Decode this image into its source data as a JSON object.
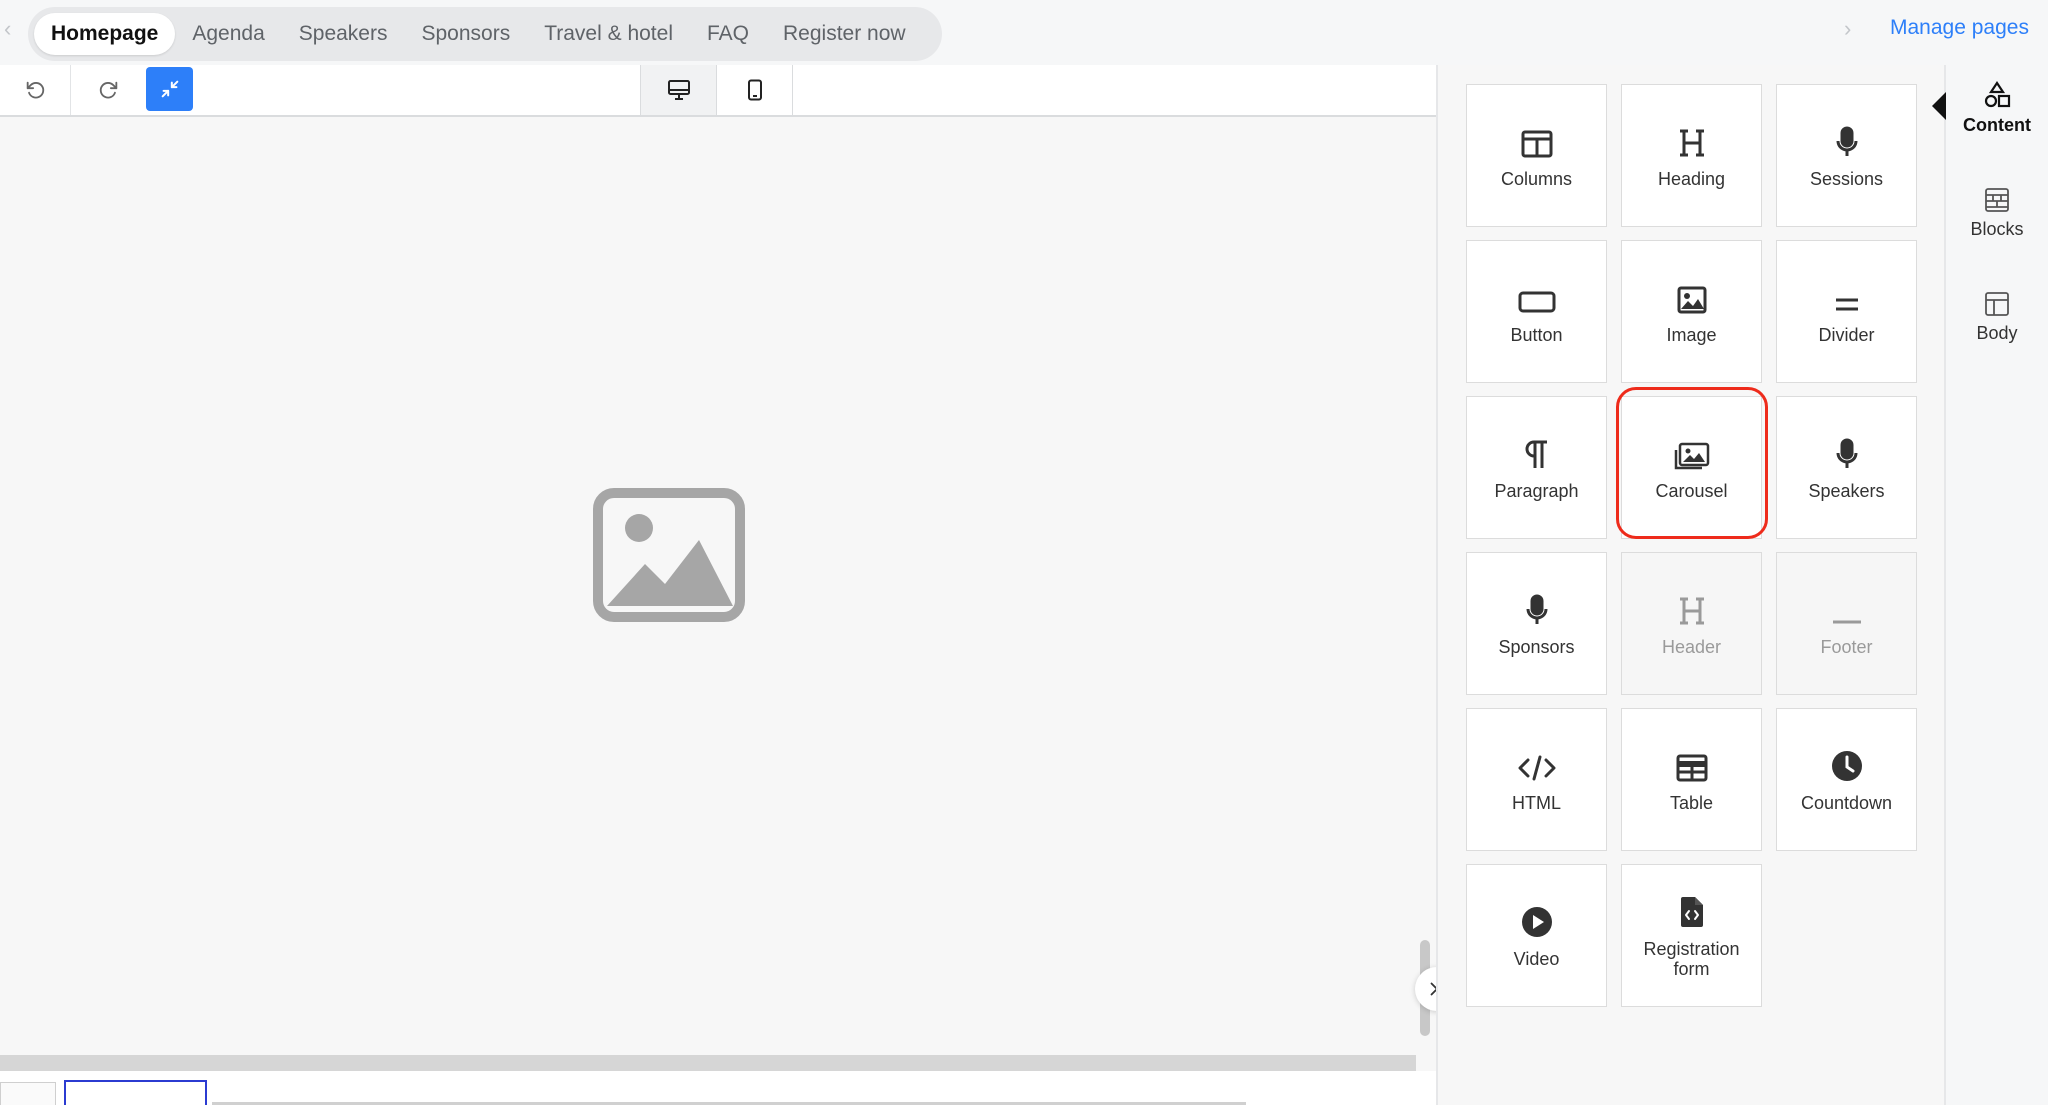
{
  "tabs": [
    {
      "label": "Homepage",
      "active": true
    },
    {
      "label": "Agenda"
    },
    {
      "label": "Speakers"
    },
    {
      "label": "Sponsors"
    },
    {
      "label": "Travel & hotel"
    },
    {
      "label": "FAQ"
    },
    {
      "label": "Register now"
    }
  ],
  "manage_pages": "Manage pages",
  "accent_color": "#2d7ff9",
  "highlight_color": "#ee2b1b",
  "content_tiles": [
    {
      "label": "Columns",
      "icon": "columns-icon"
    },
    {
      "label": "Heading",
      "icon": "heading-icon"
    },
    {
      "label": "Sessions",
      "icon": "microphone-icon"
    },
    {
      "label": "Button",
      "icon": "button-icon"
    },
    {
      "label": "Image",
      "icon": "image-icon"
    },
    {
      "label": "Divider",
      "icon": "divider-icon"
    },
    {
      "label": "Paragraph",
      "icon": "paragraph-icon"
    },
    {
      "label": "Carousel",
      "icon": "carousel-icon"
    },
    {
      "label": "Speakers",
      "icon": "microphone-icon"
    },
    {
      "label": "Sponsors",
      "icon": "microphone-icon"
    },
    {
      "label": "Header",
      "icon": "heading-icon",
      "disabled": true
    },
    {
      "label": "Footer",
      "icon": "footer-icon",
      "disabled": true
    },
    {
      "label": "HTML",
      "icon": "code-icon"
    },
    {
      "label": "Table",
      "icon": "table-icon"
    },
    {
      "label": "Countdown",
      "icon": "clock-icon"
    },
    {
      "label": "Video",
      "icon": "play-icon"
    },
    {
      "label": "Registration form",
      "icon": "form-file-icon"
    }
  ],
  "side_tabs": [
    {
      "label": "Content",
      "icon": "shapes-icon",
      "active": true
    },
    {
      "label": "Blocks",
      "icon": "blocks-icon"
    },
    {
      "label": "Body",
      "icon": "layout-icon"
    }
  ]
}
